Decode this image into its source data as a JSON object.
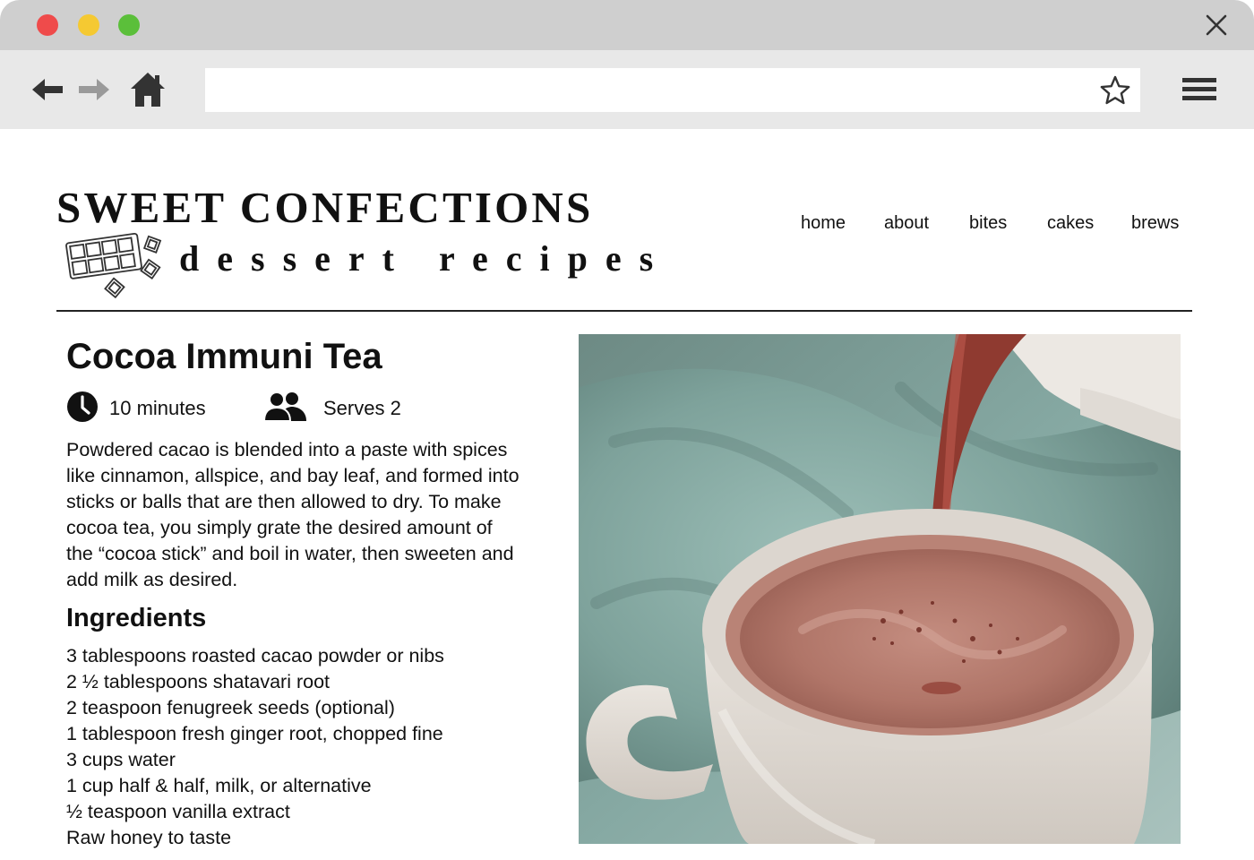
{
  "browser": {
    "url": "",
    "icons": {
      "close": "close-icon",
      "back": "arrow-left-icon",
      "forward": "arrow-right-icon",
      "home": "home-icon",
      "bookmark": "star-icon",
      "menu": "hamburger-menu-icon"
    },
    "colors": {
      "close_dot": "#ef4b4b",
      "minimize_dot": "#f5c932",
      "maximize_dot": "#5bbf3a",
      "titlebar": "#cfcfcf",
      "toolbar": "#e8e8e8"
    }
  },
  "site": {
    "title": "SWEET CONFECTIONS",
    "subtitle": "dessert recipes",
    "logo_icon": "chocolate-bar-icon",
    "nav": [
      "home",
      "about",
      "bites",
      "cakes",
      "brews"
    ]
  },
  "recipe": {
    "title": "Cocoa Immuni Tea",
    "time": "10 minutes",
    "time_icon": "clock-icon",
    "serves": "Serves 2",
    "serves_icon": "people-icon",
    "description": "Powdered cacao is blended into a paste with spices like cinnamon, allspice, and bay leaf, and formed into sticks or balls that are then allowed to dry. To make cocoa tea, you simply grate the desired amount of the “cocoa stick” and boil in water, then sweeten and add milk as desired.",
    "ingredients_heading": "Ingredients",
    "ingredients": [
      "3 tablespoons roasted cacao powder or nibs",
      "2 ½ tablespoons shatavari root",
      "2 teaspoon fenugreek seeds (optional)",
      "1 tablespoon fresh ginger root, chopped fine",
      "3 cups water",
      "1 cup half & half, milk, or alternative",
      "½ teaspoon vanilla extract",
      "Raw honey to taste"
    ],
    "photo": "hot-cocoa-pour-photo"
  }
}
